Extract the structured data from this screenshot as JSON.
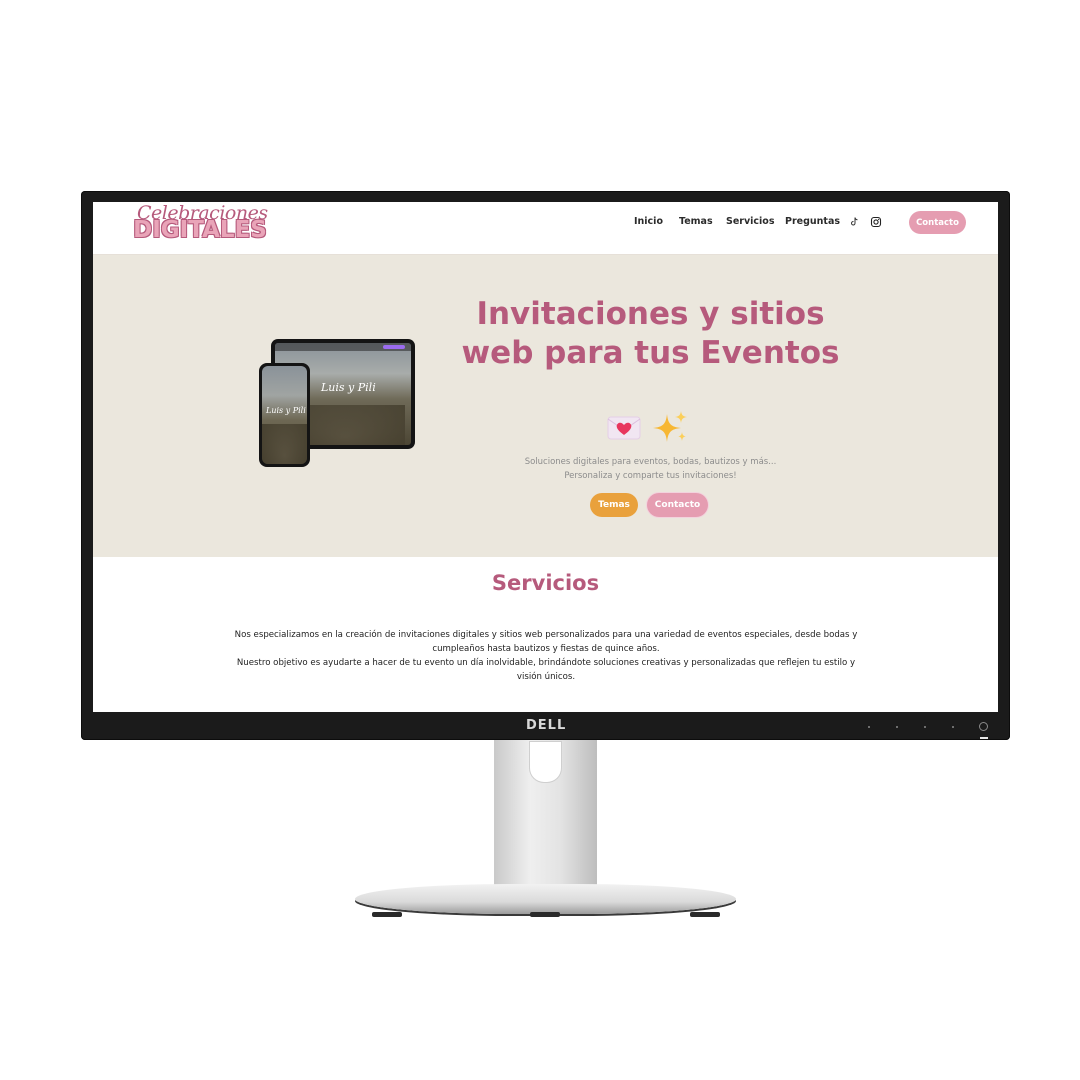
{
  "device": {
    "brand": "DELL"
  },
  "header": {
    "logo_script": "Celebraciones",
    "logo_main": "DIGITALES",
    "nav": [
      "Inicio",
      "Temas",
      "Servicios",
      "Preguntas"
    ],
    "social_icons": [
      "tiktok-icon",
      "instagram-icon"
    ],
    "cta_label": "Contacto"
  },
  "hero": {
    "title": "Invitaciones y sitios web para tus Eventos",
    "emojis": [
      "love-letter-icon",
      "sparkles-icon"
    ],
    "subtitle_line1": "Soluciones digitales para eventos, bodas, bautizos y más...",
    "subtitle_line2": "Personaliza y comparte tus invitaciones!",
    "btn_temas": "Temas",
    "btn_contacto": "Contacto",
    "mockup_script": "Luis y Pili"
  },
  "servicios": {
    "title": "Servicios",
    "para1": "Nos especializamos en la creación de invitaciones digitales y sitios web personalizados para una variedad de eventos especiales, desde bodas y cumpleaños hasta bautizos y fiestas de quince años.",
    "para2": "Nuestro objetivo es ayudarte a hacer de tu evento un día inolvidable, brindándote soluciones creativas y personalizadas que reflejen tu estilo y visión únicos."
  },
  "colors": {
    "brand_pink": "#b65a7c",
    "light_pink": "#e59db1",
    "orange": "#e9a13c",
    "hero_bg": "#ebe7dd"
  }
}
